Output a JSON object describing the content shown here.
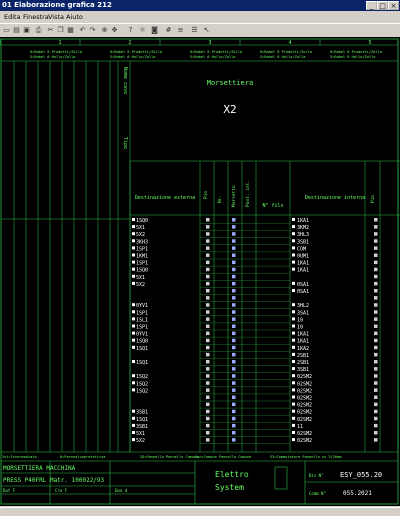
{
  "window": {
    "title": "01 Elaborazione grafica 212"
  },
  "menu": [
    "Edita",
    "Finestra",
    "Vista",
    "Aiuto"
  ],
  "toolbar_icons": [
    "new-icon",
    "open-icon",
    "save-icon",
    "print-icon",
    "cut-icon",
    "copy-icon",
    "paste-icon",
    "undo-icon",
    "redo-icon",
    "help-icon",
    "lightbulb-icon",
    "camera-icon",
    "zoom-icon",
    "pan-icon",
    "grid-icon",
    "layers-icon",
    "properties-icon",
    "arrow-icon"
  ],
  "columns": [
    "1",
    "2",
    "3",
    "4",
    "5"
  ],
  "top_notes": [
    "0=Rabel 0 Prodotti/Zolla",
    "0=Rabel 0 Prodotti/Zolla",
    "0=Rabel 0 Prodotti/Zolla",
    "0=Rabel 0 Prodotti/Zolla",
    "0=Rabel 0 Prodotti/Zolla"
  ],
  "top_notes2": [
    "S=Rabel 0 Hollo/Zolla",
    "S=Rabel 0 Hollo/Zolla",
    "S=Rabel 0 Hollo/Zolla",
    "S=Rabel 0 Hollo/Zolla",
    "S=Rabel 0 Hollo/Zolla"
  ],
  "terminal_block": {
    "title": "Morsettiera",
    "id": "X2"
  },
  "headers": {
    "nome_cavo": "Nome cavo",
    "tipo": "Tipo",
    "dest_ext": "Destinazione esterna",
    "pin1": "Pin",
    "morsetto": "Morsetto",
    "nr": "Nr.",
    "ponticello": "Pont. int.",
    "nfilo": "N° filo",
    "dest_int": "Destinazione interna",
    "pin2": "Pin"
  },
  "rows": [
    {
      "ext": "1SQ0",
      "m": "",
      "f": "",
      "int": "1KA1"
    },
    {
      "ext": "5X1",
      "m": "",
      "f": "",
      "int": "3KM2"
    },
    {
      "ext": "5X2",
      "m": "",
      "f": "",
      "int": "3HL3"
    },
    {
      "ext": "3KH3",
      "m": "",
      "f": "",
      "int": "3SB1"
    },
    {
      "ext": "1SP1",
      "m": "",
      "f": "",
      "int": "COM"
    },
    {
      "ext": "1KM1",
      "m": "",
      "f": "",
      "int": "0UM1"
    },
    {
      "ext": "1SP1",
      "m": "",
      "f": "",
      "int": "1KA1"
    },
    {
      "ext": "1SQ0",
      "m": "",
      "f": "",
      "int": "1KA1"
    },
    {
      "ext": "5X1",
      "m": "",
      "f": "",
      "int": ""
    },
    {
      "ext": "5X2",
      "m": "",
      "f": "",
      "int": "0SA1"
    },
    {
      "ext": "",
      "m": "",
      "f": "",
      "int": "0SA1"
    },
    {
      "ext": "",
      "m": "",
      "f": "",
      "int": ""
    },
    {
      "ext": "0YV1",
      "m": "",
      "f": "",
      "int": "3HL2"
    },
    {
      "ext": "1SP1",
      "m": "",
      "f": "",
      "int": "3SA1"
    },
    {
      "ext": "1SL1",
      "m": "",
      "f": "",
      "int": "10"
    },
    {
      "ext": "1SP1",
      "m": "",
      "f": "",
      "int": "10"
    },
    {
      "ext": "0YV1",
      "m": "",
      "f": "",
      "int": "1KA1"
    },
    {
      "ext": "1SQ0",
      "m": "",
      "f": "",
      "int": "1KA1"
    },
    {
      "ext": "1SQ1",
      "m": "",
      "f": "",
      "int": "1KA2"
    },
    {
      "ext": "",
      "m": "",
      "f": "",
      "int": "2SB1"
    },
    {
      "ext": "1SQ1",
      "m": "",
      "f": "",
      "int": "2SB1"
    },
    {
      "ext": "",
      "m": "",
      "f": "",
      "int": "3SB1"
    },
    {
      "ext": "1SQ2",
      "m": "",
      "f": "",
      "int": "02SM2"
    },
    {
      "ext": "1SQ2",
      "m": "",
      "f": "",
      "int": "02SM2"
    },
    {
      "ext": "1SQ2",
      "m": "",
      "f": "",
      "int": "02SM2"
    },
    {
      "ext": "",
      "m": "",
      "f": "",
      "int": "02SM2"
    },
    {
      "ext": "",
      "m": "",
      "f": "",
      "int": "02SM2"
    },
    {
      "ext": "3SB1",
      "m": "",
      "f": "",
      "int": "02SM2"
    },
    {
      "ext": "1SQ1",
      "m": "",
      "f": "",
      "int": "02SM2"
    },
    {
      "ext": "3SB1",
      "m": "",
      "f": "",
      "int": "11"
    },
    {
      "ext": "5X1",
      "m": "",
      "f": "",
      "int": "02SM2"
    },
    {
      "ext": "5X2",
      "m": "",
      "f": "",
      "int": "02SM2"
    }
  ],
  "bottom_notes": [
    "Int=Intermediato",
    "0=Paresalvaprotettiva",
    "IO=Pannello Pannello Comune",
    "Con=Comune Pannello Comune",
    "S3=Commutatore Pannello in 3/20mm"
  ],
  "title_block": {
    "subject": "MORSETTIERA MACCHINA",
    "machine": "PRESS P40FRL Matr. 100022/93",
    "fields": [
      "Dat F",
      "Cre F",
      "Emo d"
    ],
    "company_line1": "Elettro",
    "company_line2": "System",
    "dis_label": "Dis N°",
    "dis_value": "ESY_055.20",
    "comm_label": "Comm N°",
    "comm_value": "055.2021"
  },
  "colors": {
    "canvas": "#000000",
    "line": "#2fbf4a",
    "text": "#66ff66",
    "title": "#0a246a"
  }
}
